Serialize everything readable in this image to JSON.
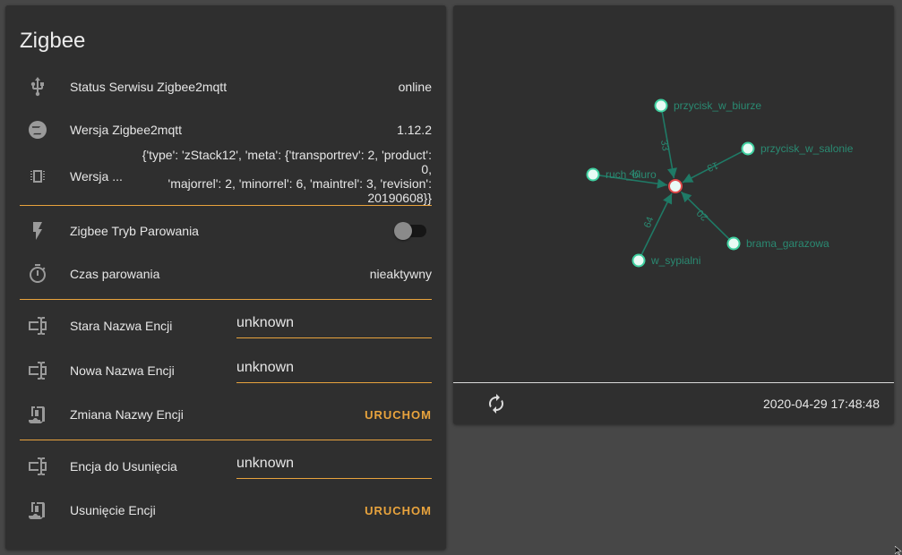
{
  "entities_card": {
    "title": "Zigbee",
    "rows": {
      "status": {
        "label": "Status Serwisu Zigbee2mqtt",
        "value": "online",
        "icon": "usb-plug-icon"
      },
      "version": {
        "label": "Wersja Zigbee2mqtt",
        "value": "1.12.2",
        "icon": "zigbee-logo-icon"
      },
      "coordinator": {
        "label": "Wersja ...",
        "value_lines": [
          "{'type': 'zStack12', 'meta': {'transportrev': 2, 'product': 0,",
          "'majorrel': 2, 'minorrel': 6, 'maintrel': 3, 'revision':",
          "20190608}}"
        ],
        "icon": "chip-icon"
      },
      "pairing_mode": {
        "label": "Zigbee Tryb Parowania",
        "state": "off",
        "icon": "flash-icon"
      },
      "pairing_time": {
        "label": "Czas parowania",
        "value": "nieaktywny",
        "icon": "timer-icon"
      },
      "old_name": {
        "label": "Stara Nazwa Encji",
        "value": "unknown",
        "icon": "form-textbox-icon"
      },
      "new_name": {
        "label": "Nowa Nazwa Encji",
        "value": "unknown",
        "icon": "form-textbox-icon"
      },
      "rename": {
        "label": "Zmiana Nazwy Encji",
        "action": "URUCHOM",
        "icon": "script-icon"
      },
      "remove_entity": {
        "label": "Encja do Usunięcia",
        "value": "unknown",
        "icon": "form-textbox-icon"
      },
      "remove": {
        "label": "Usunięcie Encji",
        "action": "URUCHOM",
        "icon": "script-icon"
      }
    }
  },
  "graph_card": {
    "nodes": [
      {
        "id": "coordinator",
        "label": "",
        "role": "coordinator"
      },
      {
        "id": "przycisk_w_biurze",
        "label": "przycisk_w_biurze",
        "link_quality": "33"
      },
      {
        "id": "przycisk_w_salonie",
        "label": "przycisk_w_salonie",
        "link_quality": "13"
      },
      {
        "id": "ruch_biuro",
        "label": "ruch_biuro",
        "link_quality": "40"
      },
      {
        "id": "brama_garazowa",
        "label": "brama_garazowa",
        "link_quality": "20"
      },
      {
        "id": "w_sypialni",
        "label": "w_sypialni",
        "link_quality": "64"
      }
    ],
    "timestamp": "2020-04-29 17:48:48",
    "refresh_icon": "refresh-icon"
  },
  "colors": {
    "accent": "#e8a33d",
    "edge": "#1f7a66",
    "node_fill": "#e9fbf5",
    "node_stroke": "#3fd0a0",
    "coordinator_stroke": "#e04b4b",
    "label": "#2a8a72"
  }
}
